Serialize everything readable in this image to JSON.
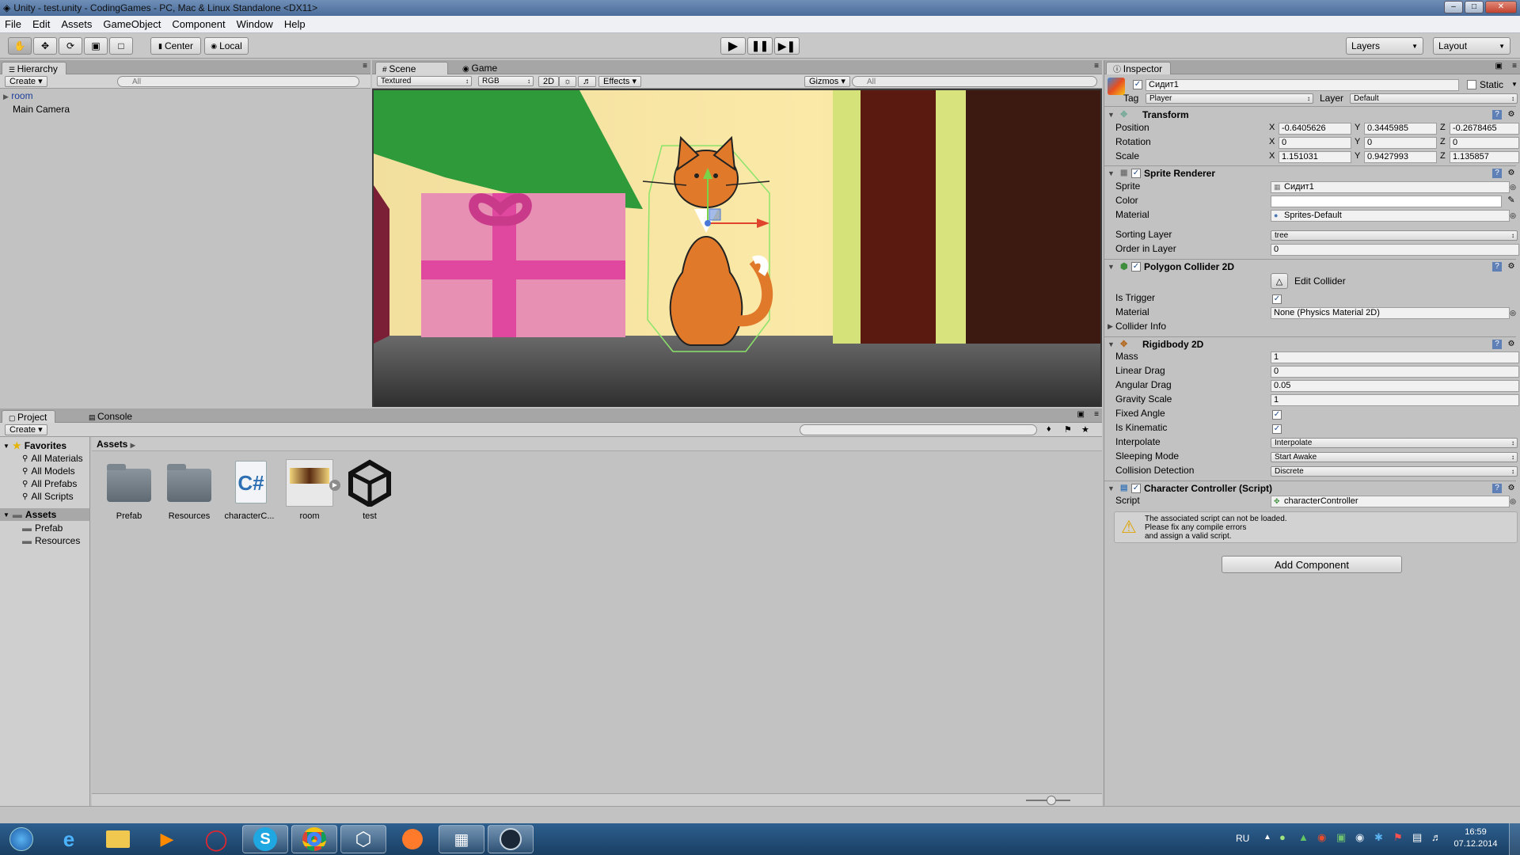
{
  "window": {
    "title": "Unity - test.unity - CodingGames - PC, Mac & Linux Standalone <DX11>",
    "min": "–",
    "max": "□",
    "close": "✕"
  },
  "menu": [
    "File",
    "Edit",
    "Assets",
    "GameObject",
    "Component",
    "Window",
    "Help"
  ],
  "toolbar": {
    "pivot": "Center",
    "space": "Local",
    "layers": "Layers",
    "layout": "Layout"
  },
  "hierarchy": {
    "tab": "Hierarchy",
    "create": "Create",
    "search_placeholder": "All",
    "items": [
      "room",
      "Main Camera"
    ]
  },
  "scene": {
    "tab_scene": "Scene",
    "tab_game": "Game",
    "shading": "Textured",
    "render": "RGB",
    "mode2d": "2D",
    "effects": "Effects",
    "gizmos": "Gizmos",
    "search_placeholder": "All"
  },
  "project": {
    "tab_project": "Project",
    "tab_console": "Console",
    "create": "Create",
    "favorites_label": "Favorites",
    "favorites": [
      "All Materials",
      "All Models",
      "All Prefabs",
      "All Scripts"
    ],
    "assets_label": "Assets",
    "asset_folders": [
      "Prefab",
      "Resources"
    ],
    "breadcrumb": "Assets",
    "assets": [
      "Prefab",
      "Resources",
      "characterC...",
      "room",
      "test"
    ]
  },
  "inspector": {
    "tab": "Inspector",
    "object_name": "Сидит1",
    "static_label": "Static",
    "tag_label": "Tag",
    "tag_value": "Player",
    "layer_label": "Layer",
    "layer_value": "Default",
    "transform": {
      "title": "Transform",
      "position_label": "Position",
      "rotation_label": "Rotation",
      "scale_label": "Scale",
      "position": [
        "-0.6405626",
        "0.3445985",
        "-0.2678465"
      ],
      "rotation": [
        "0",
        "0",
        "0"
      ],
      "scale": [
        "1.151031",
        "0.9427993",
        "1.135857"
      ]
    },
    "sprite_renderer": {
      "title": "Sprite Renderer",
      "sprite_label": "Sprite",
      "sprite_value": "Сидит1",
      "color_label": "Color",
      "material_label": "Material",
      "material_value": "Sprites-Default",
      "sorting_layer_label": "Sorting Layer",
      "sorting_layer_value": "tree",
      "order_label": "Order in Layer",
      "order_value": "0"
    },
    "polygon_collider": {
      "title": "Polygon Collider 2D",
      "edit_collider": "Edit Collider",
      "is_trigger_label": "Is Trigger",
      "material_label": "Material",
      "material_value": "None (Physics Material 2D)",
      "collider_info": "Collider Info"
    },
    "rigidbody": {
      "title": "Rigidbody 2D",
      "mass_label": "Mass",
      "mass": "1",
      "linear_drag_label": "Linear Drag",
      "linear_drag": "0",
      "angular_drag_label": "Angular Drag",
      "angular_drag": "0.05",
      "gravity_label": "Gravity Scale",
      "gravity": "1",
      "fixed_angle_label": "Fixed Angle",
      "kinematic_label": "Is Kinematic",
      "interpolate_label": "Interpolate",
      "interpolate": "Interpolate",
      "sleeping_label": "Sleeping Mode",
      "sleeping": "Start Awake",
      "collision_label": "Collision Detection",
      "collision": "Discrete"
    },
    "script": {
      "title": "Character Controller (Script)",
      "script_label": "Script",
      "script_value": "characterController",
      "warning_1": "The associated script can not be loaded.",
      "warning_2": "Please fix any compile errors",
      "warning_3": "and assign a valid script."
    },
    "add_component": "Add Component"
  },
  "taskbar": {
    "lang": "RU",
    "time": "16:59",
    "date": "07.12.2014"
  }
}
